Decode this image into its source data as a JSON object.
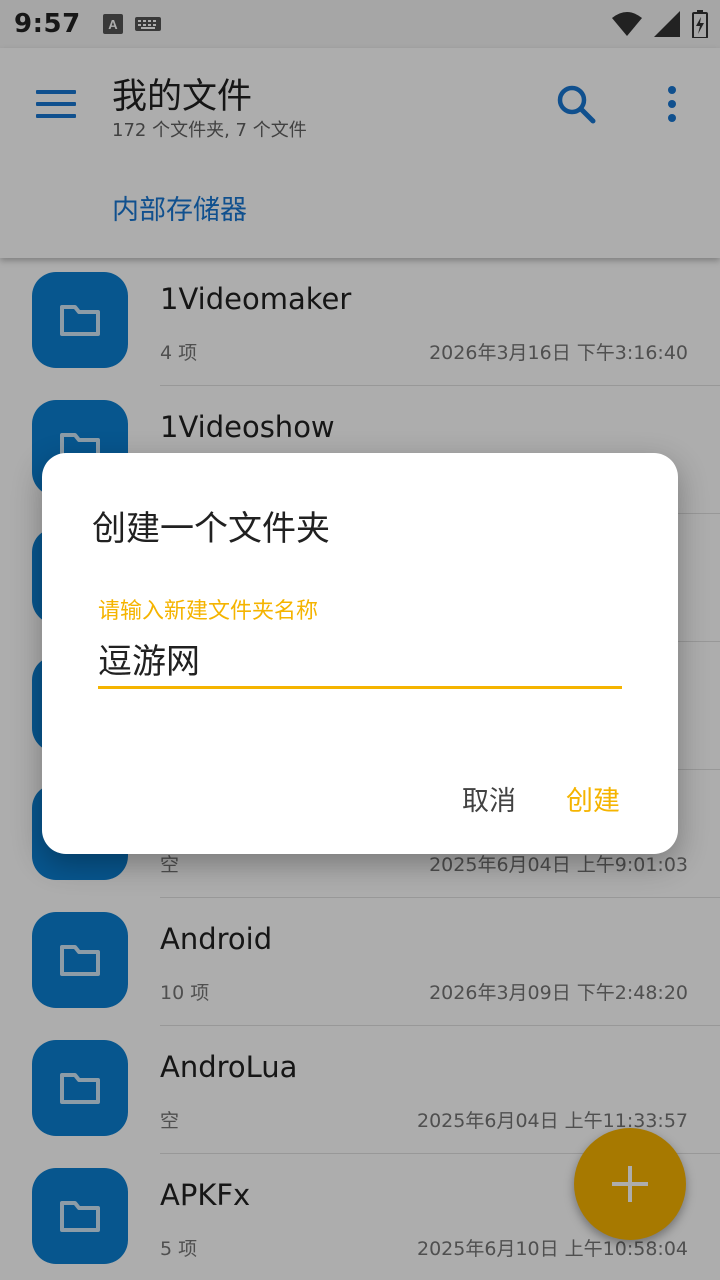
{
  "status_bar": {
    "time": "9:57",
    "icons": [
      "text-a-notification-icon",
      "keyboard-icon",
      "wifi-icon",
      "signal-icon",
      "battery-charging-icon"
    ]
  },
  "app_bar": {
    "title": "我的文件",
    "subtitle": "172 个文件夹, 7 个文件",
    "breadcrumb": "内部存储器",
    "accent_color": "#1976d2"
  },
  "folders": [
    {
      "name": "1Videomaker",
      "count": "4 项",
      "date": "2026年3月16日 下午3:16:40"
    },
    {
      "name": "1Videoshow",
      "count": "",
      "date": ""
    },
    {
      "name": "",
      "count": "",
      "date": ""
    },
    {
      "name": "",
      "count": "",
      "date": ""
    },
    {
      "name": "",
      "count": "空",
      "date": "2025年6月04日 上午9:01:03"
    },
    {
      "name": "Android",
      "count": "10 项",
      "date": "2026年3月09日 下午2:48:20"
    },
    {
      "name": "AndroLua",
      "count": "空",
      "date": "2025年6月04日 上午11:33:57"
    },
    {
      "name": "APKFx",
      "count": "5 项",
      "date": "2025年6月10日 上午10:58:04"
    }
  ],
  "dialog": {
    "title": "创建一个文件夹",
    "field_label": "请输入新建文件夹名称",
    "field_value": "逗游网",
    "cancel_label": "取消",
    "create_label": "创建",
    "accent_color": "#f5b400"
  },
  "fab": {
    "icon": "plus-icon",
    "color": "#f7b300"
  }
}
